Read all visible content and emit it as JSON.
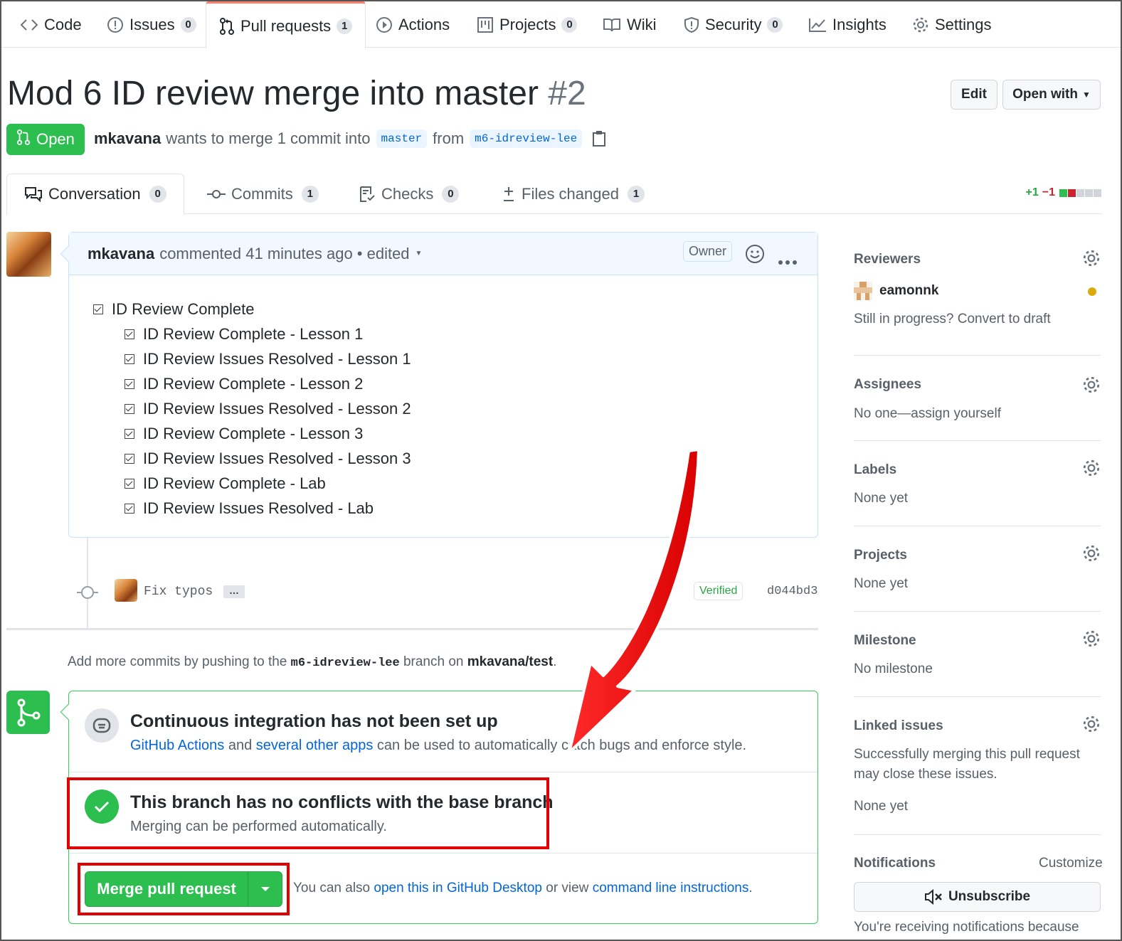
{
  "nav": {
    "tabs": [
      {
        "label": "Code",
        "icon": "code-icon"
      },
      {
        "label": "Issues",
        "count": "0",
        "icon": "issue-icon"
      },
      {
        "label": "Pull requests",
        "count": "1",
        "icon": "pull-request-icon"
      },
      {
        "label": "Actions",
        "icon": "play-icon"
      },
      {
        "label": "Projects",
        "count": "0",
        "icon": "project-icon"
      },
      {
        "label": "Wiki",
        "icon": "book-icon"
      },
      {
        "label": "Security",
        "count": "0",
        "icon": "shield-icon"
      },
      {
        "label": "Insights",
        "icon": "graph-icon"
      },
      {
        "label": "Settings",
        "icon": "gear-icon"
      }
    ]
  },
  "pr": {
    "title": "Mod 6 ID review merge into master",
    "number": "#2",
    "edit_label": "Edit",
    "open_with_label": "Open with",
    "state": "Open",
    "author": "mkavana",
    "merge_text": "wants to merge 1 commit into",
    "base": "master",
    "from_text": "from",
    "head": "m6-idreview-lee"
  },
  "pr_tabs": [
    {
      "label": "Conversation",
      "count": "0",
      "icon": "comment-discussion-icon"
    },
    {
      "label": "Commits",
      "count": "1",
      "icon": "commit-icon"
    },
    {
      "label": "Checks",
      "count": "0",
      "icon": "checklist-icon"
    },
    {
      "label": "Files changed",
      "count": "1",
      "icon": "diff-icon"
    }
  ],
  "diffstat": {
    "additions": "+1",
    "deletions": "−1"
  },
  "comment": {
    "author": "mkavana",
    "meta": "commented 41 minutes ago • edited",
    "role": "Owner",
    "top_item": "ID Review Complete",
    "items": [
      "ID Review Complete - Lesson 1",
      "ID Review Issues Resolved - Lesson 1",
      "ID Review Complete - Lesson 2",
      "ID Review Issues Resolved - Lesson 2",
      "ID Review Complete - Lesson 3",
      "ID Review Issues Resolved - Lesson 3",
      "ID Review Complete - Lab",
      "ID Review Issues Resolved - Lab"
    ]
  },
  "commit": {
    "message": "Fix typos",
    "verified": "Verified",
    "sha": "d044bd3"
  },
  "hint": {
    "prefix": "Add more commits by pushing to the",
    "branch": "m6-idreview-lee",
    "middle": "branch on",
    "repo": "mkavana/test",
    "suffix": "."
  },
  "merge": {
    "ci_title": "Continuous integration has not been set up",
    "ci_link1": "GitHub Actions",
    "ci_and": "and",
    "ci_link2": "several other apps",
    "ci_rest": "can be used to automatically catch bugs and enforce style.",
    "ok_title": "This branch has no conflicts with the base branch",
    "ok_sub": "Merging can be performed automatically.",
    "button": "Merge pull request",
    "alt_prefix": "You can also",
    "alt_link1": "open this in GitHub Desktop",
    "alt_mid": "or view",
    "alt_link2": "command line instructions",
    "alt_suffix": "."
  },
  "sidebar": {
    "reviewers_h": "Reviewers",
    "reviewer": "eamonnk",
    "draft_text": "Still in progress? Convert to draft",
    "assignees_h": "Assignees",
    "assignees_t": "No one—assign yourself",
    "labels_h": "Labels",
    "labels_t": "None yet",
    "projects_h": "Projects",
    "projects_t": "None yet",
    "milestone_h": "Milestone",
    "milestone_t": "No milestone",
    "linked_h": "Linked issues",
    "linked_t1": "Successfully merging this pull request",
    "linked_t2": "may close these issues.",
    "linked_t3": "None yet",
    "notif_h": "Notifications",
    "customize": "Customize",
    "unsubscribe": "Unsubscribe",
    "notif_t": "You're receiving notifications because"
  },
  "colors": {
    "green": "#2cbe4e",
    "blue_link": "#0366d6",
    "annotation_red": "#e30000",
    "tab_accent": "#f9826c"
  }
}
